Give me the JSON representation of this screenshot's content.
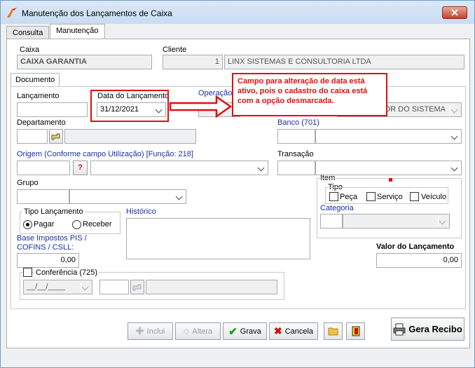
{
  "window": {
    "title": "Manutenção dos Lançamentos de Caixa",
    "close_glyph": "✕"
  },
  "tabs": [
    "Consulta",
    "Manutenção"
  ],
  "caixa": {
    "label": "Caixa",
    "value": "CAIXA GARANTIA"
  },
  "cliente": {
    "label": "Cliente",
    "code": "1",
    "name": "LINX SISTEMAS E CONSULTORIA LTDA"
  },
  "doc_tab": "Documento",
  "lancamento": {
    "label": "Lançamento",
    "value": ""
  },
  "data_lancamento": {
    "label": "Data do Lançamento",
    "value": "31/12/2021"
  },
  "operacao": {
    "label": "Operação",
    "value": "OR DO SISTEMA"
  },
  "callout": "Campo para alteração de data está ativo, pois o cadastro do caixa está com a opção desmarcada.",
  "departamento": {
    "label": "Departamento",
    "value": ""
  },
  "banco": {
    "label": "Banco (701)",
    "value": ""
  },
  "origem": {
    "label": "Origem (Conforme campo Utilização) [Função: 218]",
    "value": "",
    "btn": "?"
  },
  "transacao": {
    "label": "Transação",
    "value": ""
  },
  "grupo": {
    "label": "Grupo",
    "value": ""
  },
  "item": {
    "label": "Item",
    "tipo_label": "Tipo",
    "options": [
      "Peça",
      "Serviço",
      "Veículo"
    ],
    "categoria_label": "Categoria"
  },
  "tipo_lancamento": {
    "label": "Tipo Lançamento",
    "options": [
      "Pagar",
      "Receber"
    ],
    "selected": "Pagar"
  },
  "historico": {
    "label": "Histórico",
    "value": ""
  },
  "base_impostos": {
    "label_line1": "Base Impostos PIS /",
    "label_line2": "COFINS / CSLL:",
    "value": "0,00"
  },
  "valor_lancamento": {
    "label": "Valor do Lançamento",
    "value": "0,00"
  },
  "conferencia": {
    "label": "Conferência (725)",
    "date": "__/__/____"
  },
  "buttons": {
    "inclui": "Inclui",
    "altera": "Altera",
    "grava": "Grava",
    "cancela": "Cancela",
    "gera_recibo": "Gera Recibo"
  },
  "colors": {
    "accent_red": "#e01010",
    "label_blue": "#1a2fa8"
  }
}
